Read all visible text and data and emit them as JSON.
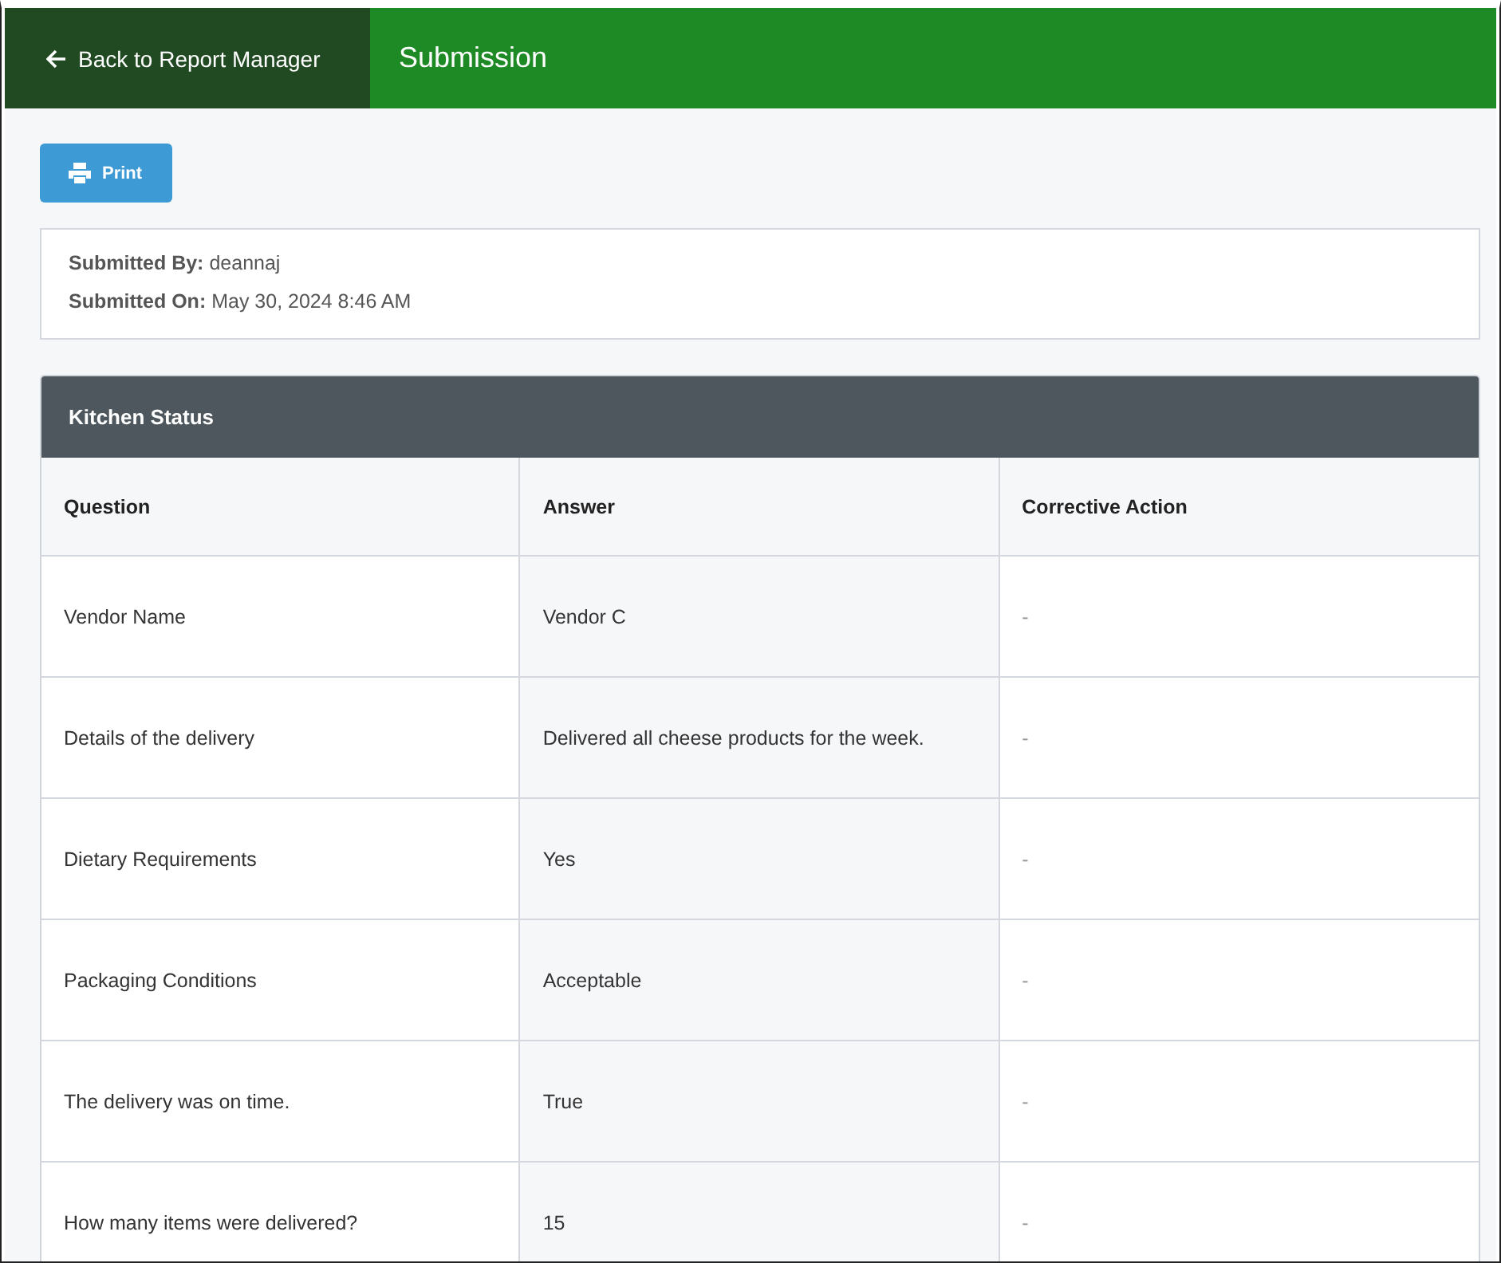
{
  "header": {
    "back_link": "Back to Report Manager",
    "title": "Submission"
  },
  "print_button": "Print",
  "submission_info": [
    {
      "label": "Submitted By:",
      "value": "deannaj"
    },
    {
      "label": "Submitted On:",
      "value": "May 30, 2024 8:46 AM"
    }
  ],
  "section": {
    "title": "Kitchen Status",
    "columns": [
      "Question",
      "Answer",
      "Corrective Action"
    ],
    "rows": [
      {
        "question": "Vendor Name",
        "answer": "Vendor C",
        "corrective_action": "-"
      },
      {
        "question": "Details of the delivery",
        "answer": "Delivered all cheese products for the week.",
        "corrective_action": "-"
      },
      {
        "question": "Dietary Requirements",
        "answer": "Yes",
        "corrective_action": "-"
      },
      {
        "question": "Packaging Conditions",
        "answer": "Acceptable",
        "corrective_action": "-"
      },
      {
        "question": "The delivery was on time.",
        "answer": "True",
        "corrective_action": "-"
      },
      {
        "question": "How many items were delivered?",
        "answer": "15",
        "corrective_action": "-"
      }
    ]
  }
}
